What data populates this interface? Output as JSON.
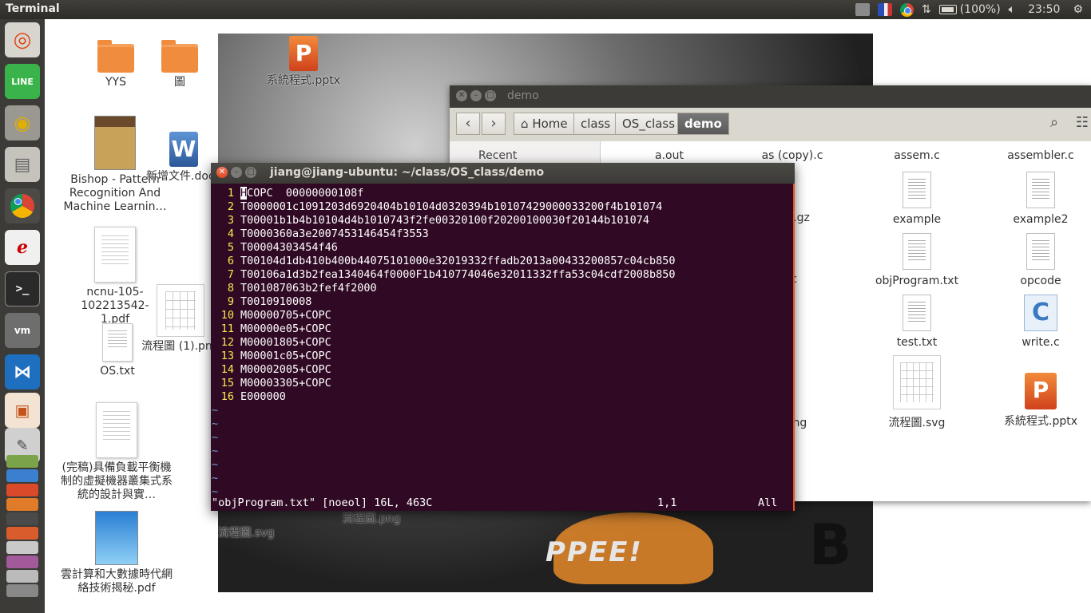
{
  "topbar": {
    "app_title": "Terminal",
    "battery_text": "(100%)",
    "time": "23:50"
  },
  "launcher": {
    "icons": [
      "ubuntu-dash-icon",
      "line-icon",
      "speaker-icon",
      "files-icon",
      "chrome-icon",
      "evince-icon",
      "terminal-icon",
      "vmware-icon",
      "vscode-icon",
      "impress-icon",
      "text-editor-icon",
      "stacked-apps-icon"
    ]
  },
  "desktop": {
    "icons": [
      {
        "label": "YYS"
      },
      {
        "label": "圖"
      },
      {
        "label": "系統程式.pptx"
      },
      {
        "label": "Bishop - Pattern Recognition And Machine Learnin…"
      },
      {
        "label": "新增文件.docx"
      },
      {
        "label": "ncnu-105-102213542-1.pdf"
      },
      {
        "label": "流程圖 (1).png"
      },
      {
        "label": "OS.txt"
      },
      {
        "label": "(完稿)具備負載平衡機制的虛擬機器叢集式系統的設計與實…"
      },
      {
        "label": "雲計算和大數據時代網絡技術揭秘.pdf"
      },
      {
        "label": "流程圖.svg"
      },
      {
        "label": "流程圖.png"
      }
    ]
  },
  "file_manager": {
    "window_title": "demo",
    "breadcrumb": [
      "Home",
      "class",
      "OS_class",
      "demo"
    ],
    "sidebar": {
      "recent": "Recent"
    },
    "files": [
      {
        "label": "a.out"
      },
      {
        "label": "as (copy).c"
      },
      {
        "label": "assem.c"
      },
      {
        "label": "assembler.c"
      },
      {
        "label": ".tar.gz"
      },
      {
        "label": "example"
      },
      {
        "label": "example2"
      },
      {
        "label": ".c"
      },
      {
        "label": "objProgram.txt"
      },
      {
        "label": "opcode"
      },
      {
        "label": "c"
      },
      {
        "label": "test.txt"
      },
      {
        "label": "write.c"
      },
      {
        "label": "].png"
      },
      {
        "label": "流程圖.svg"
      },
      {
        "label": "系統程式.pptx"
      }
    ]
  },
  "terminal": {
    "title": "jiang@jiang-ubuntu: ~/class/OS_class/demo",
    "lines": [
      {
        "n": "1",
        "t": "HCOPC  00000000108f"
      },
      {
        "n": "2",
        "t": "T0000001c1091203d6920404b10104d0320394b10107429000033200f4b101074"
      },
      {
        "n": "3",
        "t": "T00001b1b4b10104d4b1010743f2fe00320100f20200100030f20144b101074"
      },
      {
        "n": "4",
        "t": "T0000360a3e2007453146454f3553"
      },
      {
        "n": "5",
        "t": "T00004303454f46"
      },
      {
        "n": "6",
        "t": "T00104d1db410b400b44075101000e32019332ffadb2013a00433200857c04cb850"
      },
      {
        "n": "7",
        "t": "T00106a1d3b2fea1340464f0000F1b410774046e32011332ffa53c04cdf2008b850"
      },
      {
        "n": "8",
        "t": "T001087063b2fef4f2000"
      },
      {
        "n": "9",
        "t": "T0010910008"
      },
      {
        "n": "10",
        "t": "M00000705+COPC"
      },
      {
        "n": "11",
        "t": "M00000e05+COPC"
      },
      {
        "n": "12",
        "t": "M00001805+COPC"
      },
      {
        "n": "13",
        "t": "M00001c05+COPC"
      },
      {
        "n": "14",
        "t": "M00002005+COPC"
      },
      {
        "n": "15",
        "t": "M00003305+COPC"
      },
      {
        "n": "16",
        "t": "E000000"
      }
    ],
    "tilde_count": 7,
    "status_file": "\"objProgram.txt\" [noeol] 16L, 463C",
    "status_pos": "1,1",
    "status_all": "All"
  }
}
